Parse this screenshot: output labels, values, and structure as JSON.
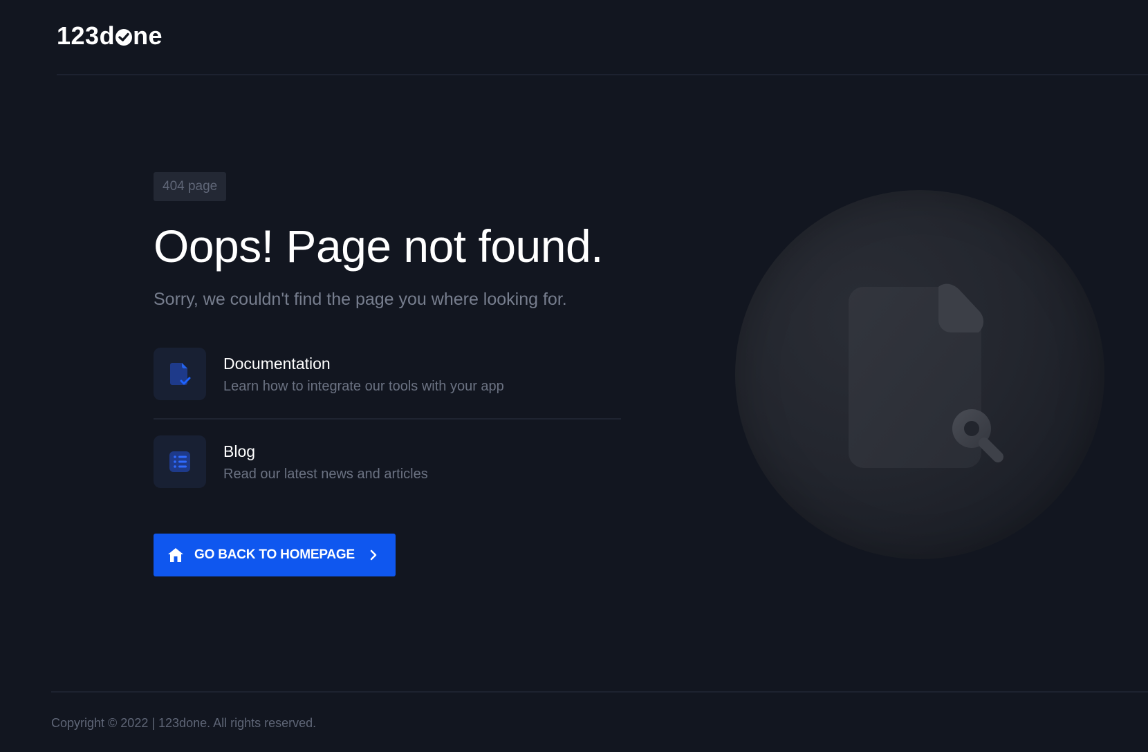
{
  "header": {
    "logo_prefix": "123d",
    "logo_suffix": "ne"
  },
  "main": {
    "badge": "404 page",
    "title": "Oops! Page not found.",
    "subtitle": "Sorry, we couldn't find the page you where looking for.",
    "links": [
      {
        "title": "Documentation",
        "description": "Learn how to integrate our tools with your app",
        "icon": "document-check-icon"
      },
      {
        "title": "Blog",
        "description": "Read our latest news and articles",
        "icon": "list-icon"
      }
    ],
    "home_button": {
      "label": "GO BACK TO HOMEPAGE",
      "icon": "home-icon",
      "trailing_icon": "chevron-right-icon"
    }
  },
  "illustration": {
    "icon": "file-search-icon"
  },
  "footer": {
    "copyright": "Copyright © 2022 | 123done. All rights reserved."
  },
  "colors": {
    "background": "#121620",
    "accent": "#0f57ef",
    "icon_box": "#182033",
    "muted_text": "#777e8e"
  }
}
